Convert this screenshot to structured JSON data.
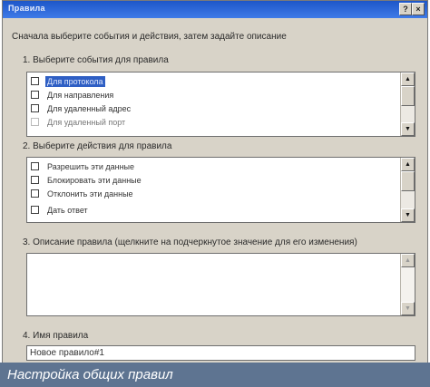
{
  "window": {
    "title": "Правила",
    "help_label": "?",
    "close_label": "×"
  },
  "instruction": "Сначала выберите события и действия, затем задайте описание",
  "section1": {
    "label": "1. Выберите события для правила",
    "items": [
      {
        "label": "Для протокола",
        "selected": true
      },
      {
        "label": "Для направления",
        "selected": false
      },
      {
        "label": "Для удаленный адрес",
        "selected": false
      },
      {
        "label": "Для удаленный порт",
        "selected": false
      }
    ]
  },
  "section2": {
    "label": "2. Выберите действия для правила",
    "items": [
      {
        "label": "Разрешить эти данные"
      },
      {
        "label": "Блокировать эти данные"
      },
      {
        "label": "Отклонить эти данные"
      },
      {
        "label": "Дать ответ"
      }
    ]
  },
  "section3": {
    "label": "3. Описание правила (щелкните на подчеркнутое значение для его изменения)",
    "value": ""
  },
  "section4": {
    "label": "4. Имя правила",
    "value": "Новое правило#1"
  },
  "caption": "Настройка общих правил",
  "colors": {
    "titlebar": "#2a62d4",
    "dialog_bg": "#d8d3c8",
    "selection": "#2f5fc4",
    "caption_bg": "#5e7491"
  }
}
